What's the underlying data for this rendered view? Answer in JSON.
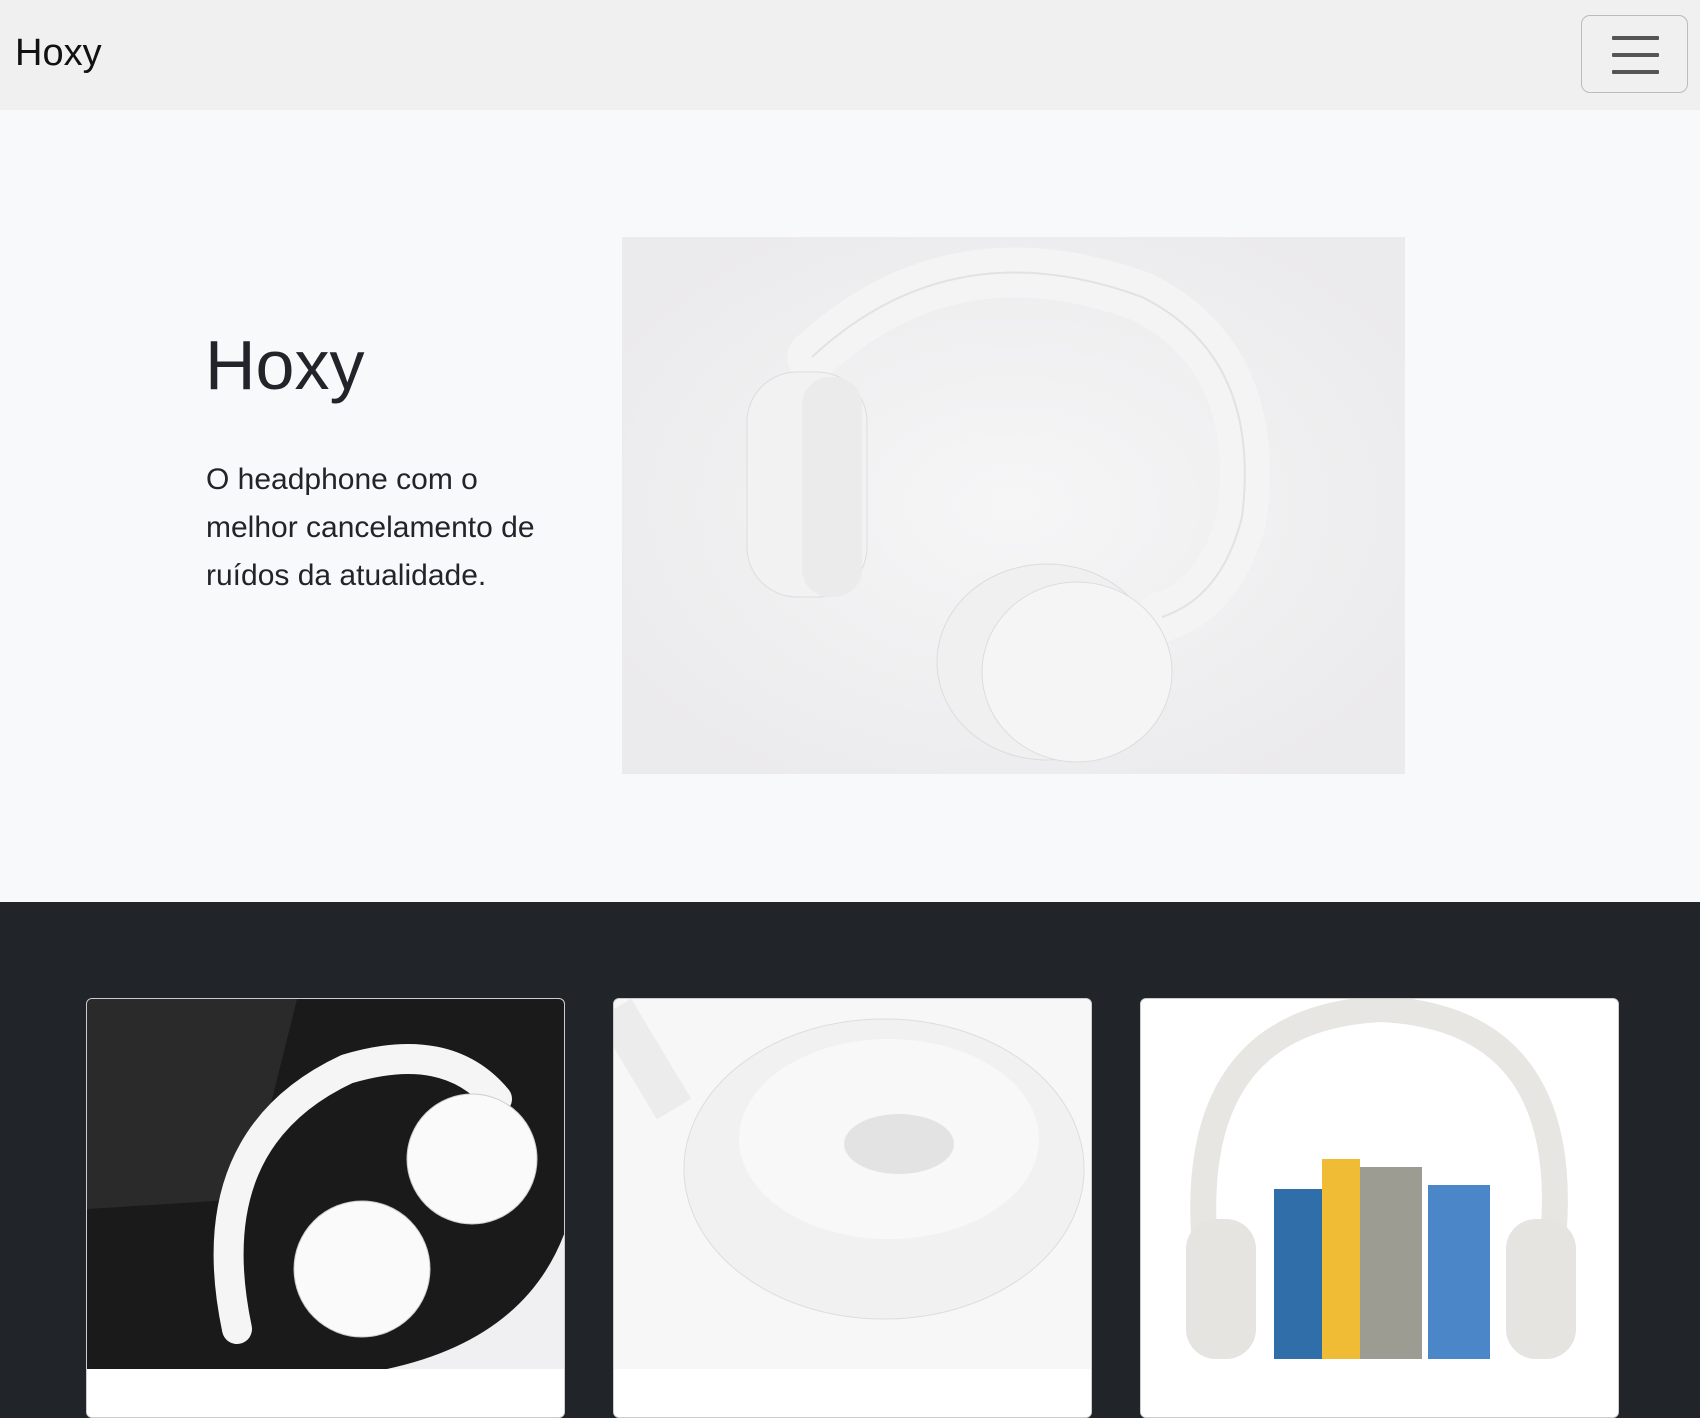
{
  "navbar": {
    "brand": "Hoxy",
    "toggler_icon": "hamburger-menu-icon"
  },
  "hero": {
    "title": "Hoxy",
    "text": "O headphone com o melhor cancelamento de ruídos da atualidade.",
    "image": "white-headphones-photo"
  },
  "cards": [
    {
      "image": "headphones-in-case-photo"
    },
    {
      "image": "headphone-earcup-closeup-photo"
    },
    {
      "image": "headphones-on-books-photo"
    }
  ],
  "colors": {
    "navbar_bg": "#f0f0f0",
    "hero_bg": "#f8f9fa",
    "dark_bg": "#212529",
    "text": "#212529"
  }
}
